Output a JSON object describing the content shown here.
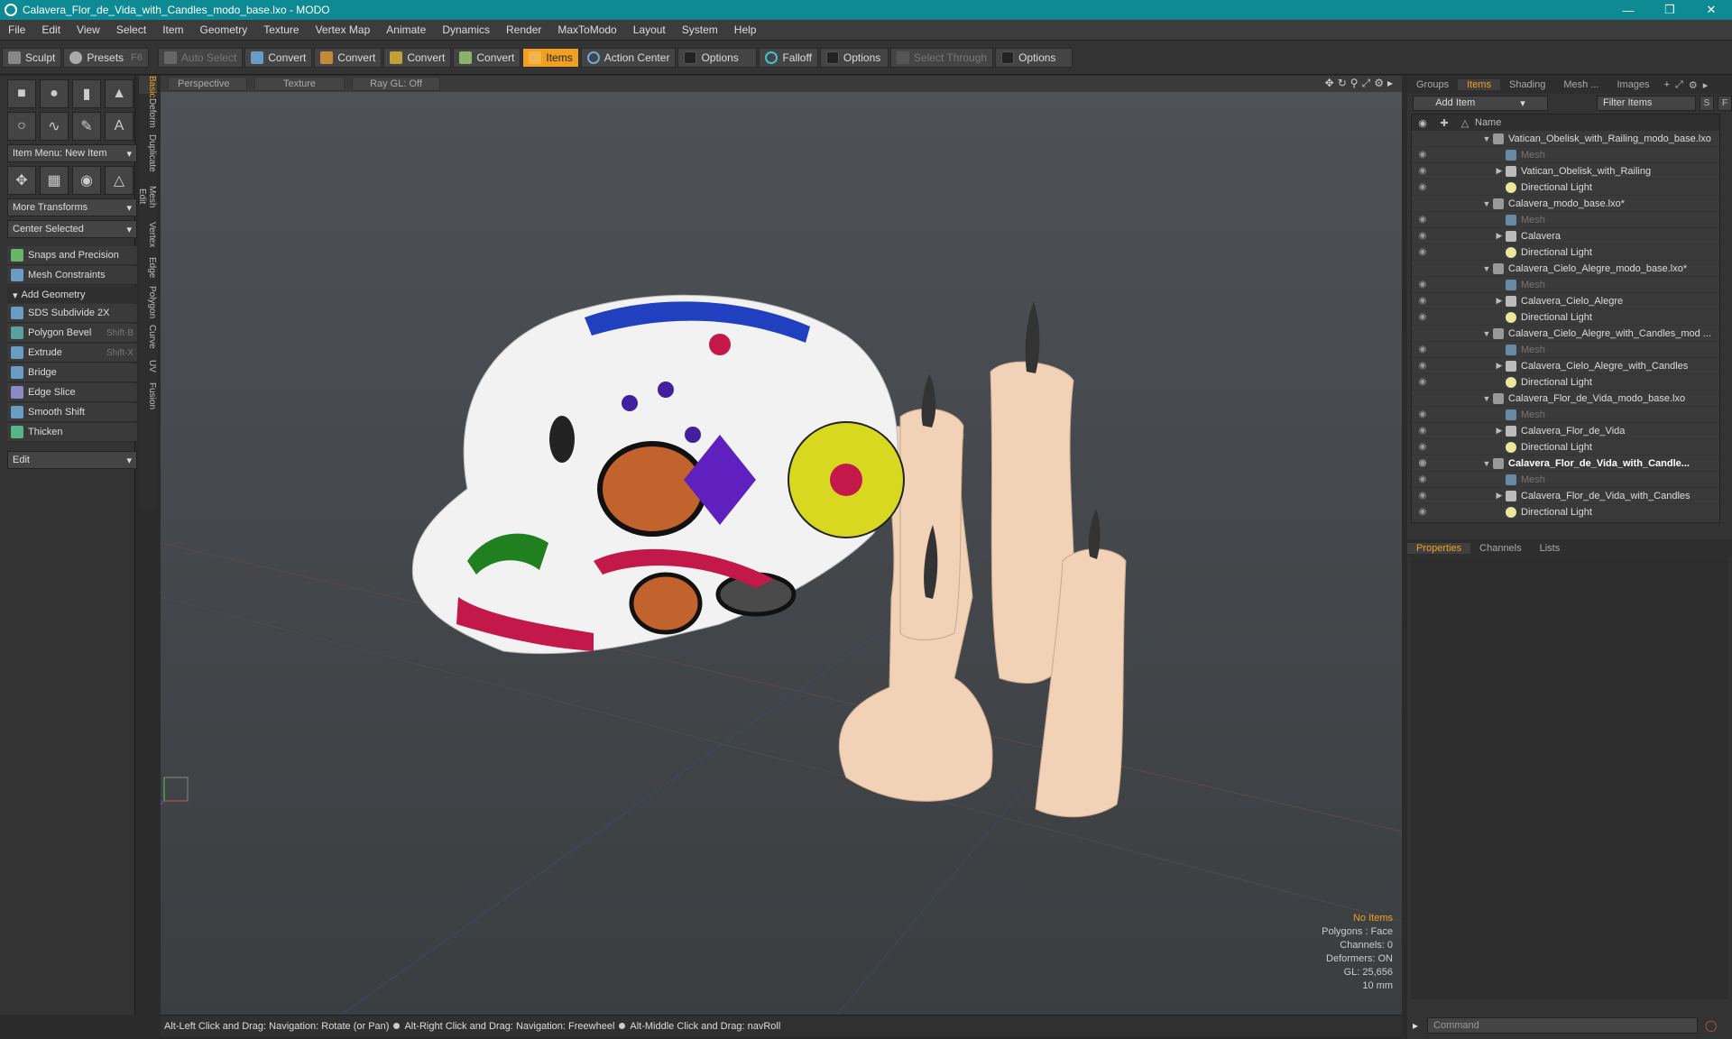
{
  "window": {
    "title": "Calavera_Flor_de_Vida_with_Candles_modo_base.lxo - MODO",
    "minimize_icon": "minimize-icon",
    "maximize_icon": "restore-icon",
    "close_icon": "close-icon"
  },
  "menubar": [
    "File",
    "Edit",
    "View",
    "Select",
    "Item",
    "Geometry",
    "Texture",
    "Vertex Map",
    "Animate",
    "Dynamics",
    "Render",
    "MaxToModo",
    "Layout",
    "System",
    "Help"
  ],
  "toolbar": {
    "sculpt": "Sculpt",
    "presets": "Presets",
    "presets_hotkey": "F6",
    "auto_select": "Auto Select",
    "convert1": "Convert",
    "convert2": "Convert",
    "convert3": "Convert",
    "convert4": "Convert",
    "items": "Items",
    "action_center": "Action Center",
    "options1": "Options",
    "falloff": "Falloff",
    "options2": "Options",
    "select_through": "Select Through",
    "options3": "Options"
  },
  "left_panel": {
    "vertical_tabs": [
      "Basic",
      "Deform",
      "Duplicate",
      "Mesh Edit",
      "Vertex",
      "Edge",
      "Polygon",
      "Curve",
      "UV",
      "Fusion"
    ],
    "item_menu": "Item Menu: New Item",
    "more_transforms": "More Transforms",
    "center_selected": "Center Selected",
    "snaps": "Snaps and Precision",
    "mesh_constraints": "Mesh Constraints",
    "add_geometry": "Add Geometry",
    "tools": [
      {
        "label": "SDS Subdivide 2X",
        "hotkey": ""
      },
      {
        "label": "Polygon Bevel",
        "hotkey": "Shift-B"
      },
      {
        "label": "Extrude",
        "hotkey": "Shift-X"
      },
      {
        "label": "Bridge",
        "hotkey": ""
      },
      {
        "label": "Edge Slice",
        "hotkey": ""
      },
      {
        "label": "Smooth Shift",
        "hotkey": ""
      },
      {
        "label": "Thicken",
        "hotkey": ""
      }
    ],
    "edit_dropdown": "Edit"
  },
  "viewport": {
    "view_mode": "Perspective",
    "shading_mode": "Texture",
    "raygl": "Ray GL: Off",
    "info": {
      "no_items": "No Items",
      "polygons": "Polygons : Face",
      "channels": "Channels: 0",
      "deformers": "Deformers: ON",
      "gl": "GL: 25,656",
      "scale": "10 mm"
    }
  },
  "statusbar": {
    "hint1": "Alt-Left Click and Drag: Navigation: Rotate (or Pan)",
    "hint2": "Alt-Right Click and Drag: Navigation: Freewheel",
    "hint3": "Alt-Middle Click and Drag: navRoll"
  },
  "right_panel": {
    "tabs": [
      "Groups",
      "Items",
      "Shading",
      "Mesh ...",
      "Images"
    ],
    "active_tab": "Items",
    "add_item": "Add Item",
    "filter_items": "Filter Items",
    "btn_s": "S",
    "btn_f": "F",
    "col_name": "Name",
    "tree": [
      {
        "label": "Vatican_Obelisk_with_Railing_modo_base.lxo",
        "level": 0,
        "type": "scene",
        "expand": "▼",
        "eye": false,
        "bold": false,
        "dim": false
      },
      {
        "label": "Mesh",
        "level": 1,
        "type": "mesh",
        "expand": "",
        "eye": true,
        "bold": false,
        "dim": true
      },
      {
        "label": "Vatican_Obelisk_with_Railing",
        "level": 1,
        "type": "group",
        "expand": "▶",
        "eye": true,
        "bold": false,
        "dim": false
      },
      {
        "label": "Directional Light",
        "level": 1,
        "type": "light",
        "expand": "",
        "eye": true,
        "bold": false,
        "dim": false
      },
      {
        "label": "Calavera_modo_base.lxo*",
        "level": 0,
        "type": "scene",
        "expand": "▼",
        "eye": false,
        "bold": false,
        "dim": false
      },
      {
        "label": "Mesh",
        "level": 1,
        "type": "mesh",
        "expand": "",
        "eye": true,
        "bold": false,
        "dim": true
      },
      {
        "label": "Calavera",
        "level": 1,
        "type": "group",
        "expand": "▶",
        "eye": true,
        "bold": false,
        "dim": false
      },
      {
        "label": "Directional Light",
        "level": 1,
        "type": "light",
        "expand": "",
        "eye": true,
        "bold": false,
        "dim": false
      },
      {
        "label": "Calavera_Cielo_Alegre_modo_base.lxo*",
        "level": 0,
        "type": "scene",
        "expand": "▼",
        "eye": false,
        "bold": false,
        "dim": false
      },
      {
        "label": "Mesh",
        "level": 1,
        "type": "mesh",
        "expand": "",
        "eye": true,
        "bold": false,
        "dim": true
      },
      {
        "label": "Calavera_Cielo_Alegre",
        "level": 1,
        "type": "group",
        "expand": "▶",
        "eye": true,
        "bold": false,
        "dim": false
      },
      {
        "label": "Directional Light",
        "level": 1,
        "type": "light",
        "expand": "",
        "eye": true,
        "bold": false,
        "dim": false
      },
      {
        "label": "Calavera_Cielo_Alegre_with_Candles_mod ...",
        "level": 0,
        "type": "scene",
        "expand": "▼",
        "eye": false,
        "bold": false,
        "dim": false
      },
      {
        "label": "Mesh",
        "level": 1,
        "type": "mesh",
        "expand": "",
        "eye": true,
        "bold": false,
        "dim": true
      },
      {
        "label": "Calavera_Cielo_Alegre_with_Candles",
        "level": 1,
        "type": "group",
        "expand": "▶",
        "eye": true,
        "bold": false,
        "dim": false
      },
      {
        "label": "Directional Light",
        "level": 1,
        "type": "light",
        "expand": "",
        "eye": true,
        "bold": false,
        "dim": false
      },
      {
        "label": "Calavera_Flor_de_Vida_modo_base.lxo",
        "level": 0,
        "type": "scene",
        "expand": "▼",
        "eye": false,
        "bold": false,
        "dim": false
      },
      {
        "label": "Mesh",
        "level": 1,
        "type": "mesh",
        "expand": "",
        "eye": true,
        "bold": false,
        "dim": true
      },
      {
        "label": "Calavera_Flor_de_Vida",
        "level": 1,
        "type": "group",
        "expand": "▶",
        "eye": true,
        "bold": false,
        "dim": false
      },
      {
        "label": "Directional Light",
        "level": 1,
        "type": "light",
        "expand": "",
        "eye": true,
        "bold": false,
        "dim": false
      },
      {
        "label": "Calavera_Flor_de_Vida_with_Candle...",
        "level": 0,
        "type": "scene",
        "expand": "▼",
        "eye": true,
        "bold": true,
        "dim": false
      },
      {
        "label": "Mesh",
        "level": 1,
        "type": "mesh",
        "expand": "",
        "eye": true,
        "bold": false,
        "dim": true
      },
      {
        "label": "Calavera_Flor_de_Vida_with_Candles",
        "level": 1,
        "type": "group",
        "expand": "▶",
        "eye": true,
        "bold": false,
        "dim": false
      },
      {
        "label": "Directional Light",
        "level": 1,
        "type": "light",
        "expand": "",
        "eye": true,
        "bold": false,
        "dim": false
      }
    ],
    "props_tabs": [
      "Properties",
      "Channels",
      "Lists"
    ],
    "props_active": "Properties",
    "command_placeholder": "Command"
  },
  "colors": {
    "accent": "#f0a020",
    "titlebar": "#0e8a94",
    "skull": "#f2f2f2",
    "candle": "#f1d2b6",
    "wick": "#333333"
  }
}
